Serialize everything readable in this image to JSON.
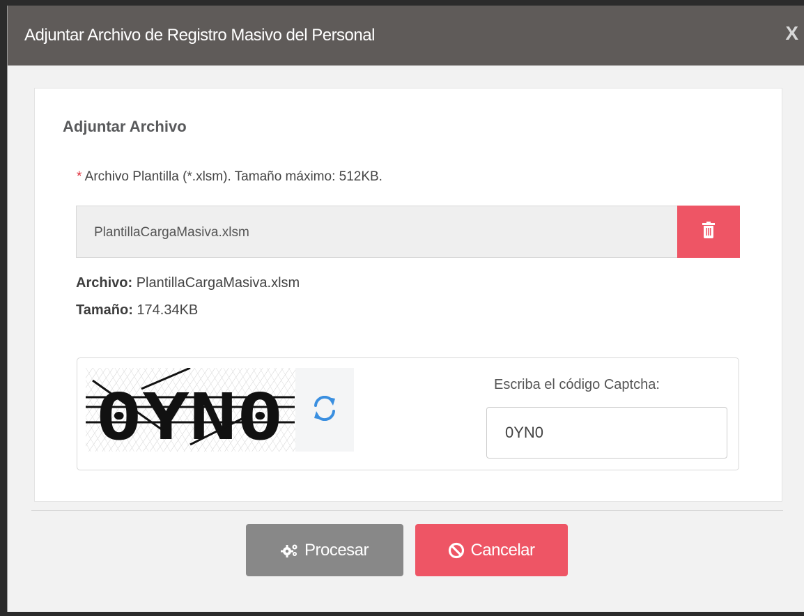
{
  "modal": {
    "title": "Adjuntar Archivo de Registro Masivo del Personal",
    "close_label": "X"
  },
  "panel": {
    "heading": "Adjuntar Archivo",
    "required_mark": "*",
    "field_label": "Archivo Plantilla (*.xlsm). Tamaño máximo: 512KB.",
    "file_name": "PlantillaCargaMasiva.xlsm",
    "delete_icon": "trash-icon"
  },
  "file_info": {
    "archivo_label": "Archivo:",
    "archivo_value": "PlantillaCargaMasiva.xlsm",
    "tamano_label": "Tamaño:",
    "tamano_value": "174.34KB"
  },
  "captcha": {
    "image_text": "0YN0",
    "refresh_icon": "refresh-icon",
    "label": "Escriba el código Captcha:",
    "input_value": "0YN0"
  },
  "footer": {
    "procesar_label": "Procesar",
    "procesar_icon": "cogs-icon",
    "cancelar_label": "Cancelar",
    "cancelar_icon": "ban-icon"
  },
  "colors": {
    "header_bg": "#5f5b59",
    "danger": "#ee5565",
    "secondary": "#888888",
    "refresh": "#3a8fe0"
  }
}
